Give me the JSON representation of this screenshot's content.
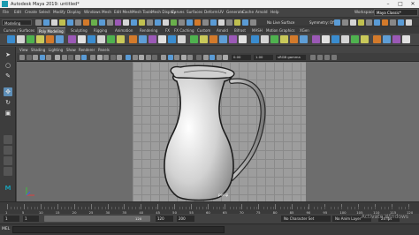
{
  "window": {
    "title": "Autodesk Maya 2019: untitled*"
  },
  "menubar": {
    "items": [
      "File",
      "Edit",
      "Create",
      "Select",
      "Modify",
      "Display",
      "Windows",
      "Mesh",
      "Edit Mesh",
      "Mesh Tools",
      "Mesh Display",
      "Curves",
      "Surfaces",
      "Deform",
      "UV",
      "Generate",
      "Cache",
      "Arnold",
      "Help"
    ],
    "workspace_label": "Workspace:",
    "workspace_value": "Maya Classic*"
  },
  "statusline": {
    "mode": "Modeling",
    "live_surface": "No Live Surface",
    "symmetry": "Symmetry: Off"
  },
  "shelf": {
    "tabs": [
      "Curves / Surfaces",
      "Poly Modeling",
      "Sculpting",
      "Rigging",
      "Animation",
      "Rendering",
      "FX",
      "FX Caching",
      "Custom",
      "Arnold",
      "Bifrost",
      "MASH",
      "Motion Graphics",
      "XGen"
    ],
    "active_index": 1
  },
  "panel": {
    "menus": [
      "View",
      "Shading",
      "Lighting",
      "Show",
      "Renderer",
      "Panels"
    ],
    "field_a": "0.00",
    "field_b": "1.00",
    "colorspace": "sRGB gamma",
    "camera_label": "persp"
  },
  "timeline": {
    "ticks": [
      "1",
      "5",
      "10",
      "15",
      "20",
      "25",
      "30",
      "35",
      "40",
      "45",
      "50",
      "55",
      "60",
      "65",
      "70",
      "75",
      "80",
      "85",
      "90",
      "95",
      "100",
      "105",
      "110",
      "115",
      "120"
    ]
  },
  "range": {
    "start": "1",
    "start_inner": "1",
    "end_inner": "120",
    "end": "120",
    "end2": "200",
    "character_set": "No Character Set",
    "anim_layer": "No Anim Layer",
    "fps": "24 fps"
  },
  "cmdline": {
    "label": "MEL",
    "watermark": "Activate Windows"
  },
  "colors": {
    "accent": "#1c9bb0",
    "shelf_icon_palette": [
      "#3a8ccf",
      "#d4d4d4",
      "#4fb24f",
      "#c9c95a",
      "#d37a2b",
      "#5f9ed6",
      "#9b59b6",
      "#e0e0e0"
    ]
  }
}
